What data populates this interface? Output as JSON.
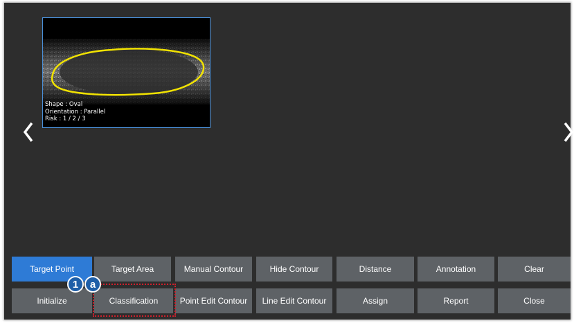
{
  "thumbnail": {
    "info_lines": [
      "Shape : Oval",
      "Orientation : Parallel",
      "Risk : 1 / 2 / 3"
    ]
  },
  "nav": {
    "prev_icon": "chevron-left-icon",
    "next_icon": "chevron-right-icon"
  },
  "toolbar": {
    "row1": [
      "Target Point",
      "Target Area",
      "Manual Contour",
      "Hide Contour",
      "Distance",
      "Annotation",
      "Clear"
    ],
    "row2": [
      "Initialize",
      "Classification",
      "Point Edit Contour",
      "Line Edit Contour",
      "Assign",
      "Report",
      "Close"
    ],
    "active": "Target Point"
  },
  "callouts": {
    "marker_1": "1",
    "marker_a": "a"
  },
  "colors": {
    "panel_bg": "#2d2d2d",
    "button_bg": "#5e6266",
    "active_button_bg": "#2e7bd6",
    "contour": "#f2e300",
    "highlight": "#d21f2c",
    "marker_bg": "#1f5fa8"
  }
}
